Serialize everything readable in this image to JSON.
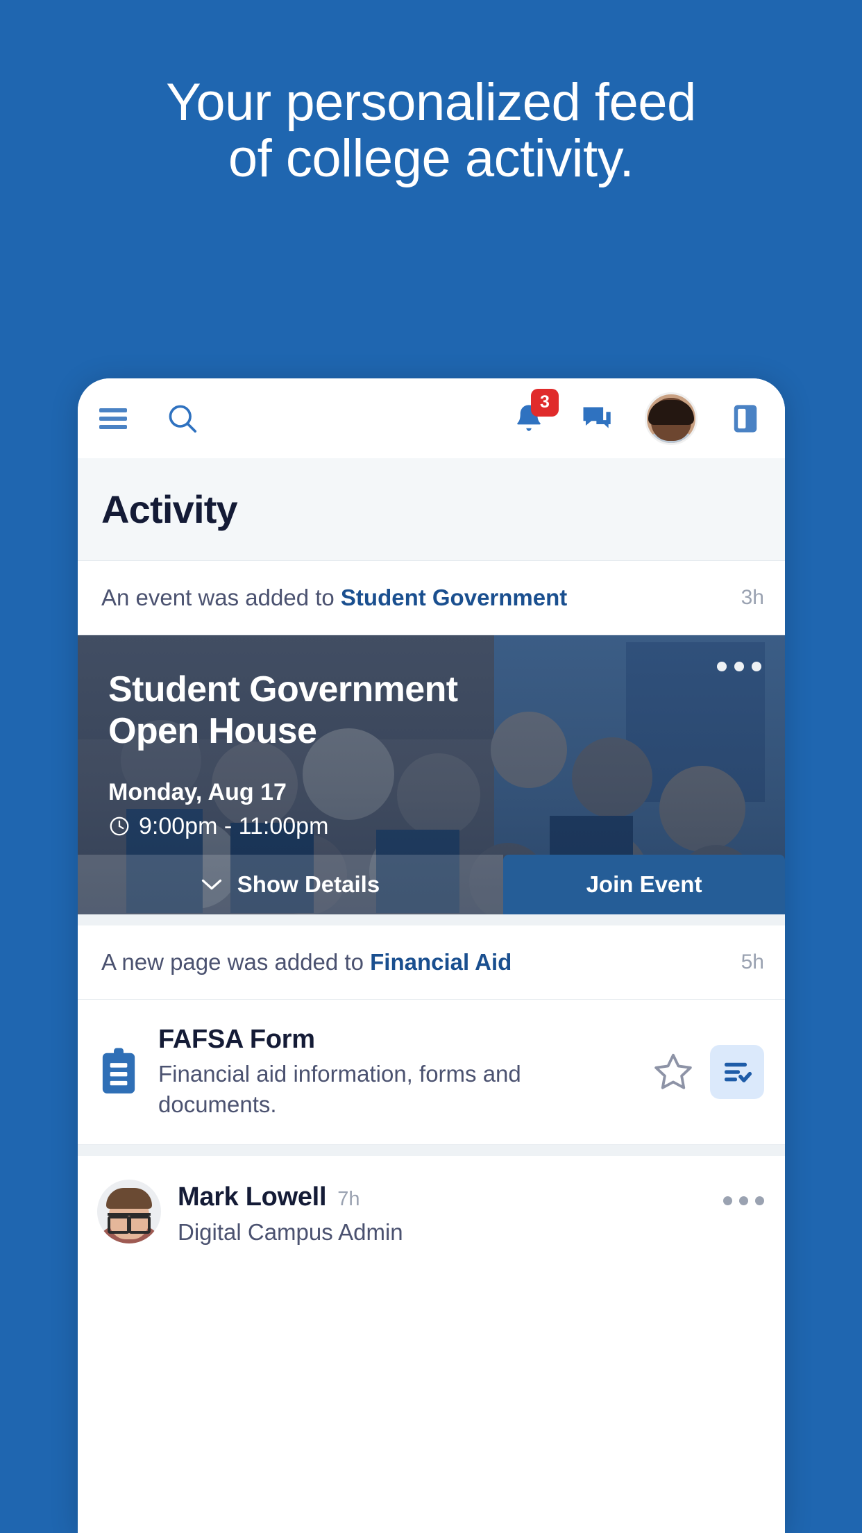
{
  "hero": {
    "line1": "Your personalized feed",
    "line2": "of college activity."
  },
  "colors": {
    "background_blue": "#1f66b0",
    "brand_blue": "#255d97",
    "link_blue": "#1a4f8f",
    "badge_red": "#e02b2b",
    "icon_blue": "#4a82c4",
    "heading_navy": "#141b36",
    "chip_bg": "#dbe9fb"
  },
  "toolbar": {
    "menu_icon": "hamburger-menu-icon",
    "search_icon": "search-icon",
    "notifications_icon": "bell-icon",
    "notifications_badge": "3",
    "messages_icon": "chat-bubble-icon",
    "avatar_icon": "user-avatar",
    "reader_icon": "book-layout-icon"
  },
  "page": {
    "title": "Activity"
  },
  "feed": {
    "event_item": {
      "meta_prefix": "An event was added to ",
      "meta_group": "Student Government",
      "time": "3h",
      "overflow_icon": "more-horizontal-icon",
      "title": "Student Government Open House",
      "date": "Monday, Aug 17",
      "clock_icon": "clock-icon",
      "time_range": "9:00pm - 11:00pm",
      "details_icon": "chevron-down-icon",
      "details_label": "Show Details",
      "join_label": "Join Event"
    },
    "page_item": {
      "meta_prefix": "A new page was added to ",
      "meta_group": "Financial Aid",
      "time": "5h",
      "doc_icon": "clipboard-icon",
      "title": "FAFSA Form",
      "description": "Financial aid information, forms and documents.",
      "star_icon": "star-outline-icon",
      "checklist_icon": "checklist-icon"
    },
    "post_item": {
      "avatar_icon": "user-avatar",
      "name": "Mark Lowell",
      "time": "7h",
      "role": "Digital Campus Admin",
      "overflow_icon": "more-horizontal-icon"
    }
  }
}
